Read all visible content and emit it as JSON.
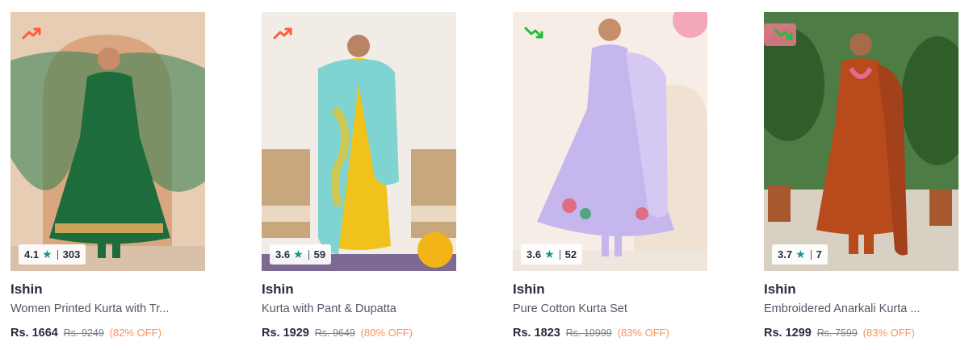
{
  "products": [
    {
      "brand": "Ishin",
      "title": "Women Printed Kurta with Tr...",
      "price": "Rs. 1664",
      "mrp": "Rs. 9249",
      "discount": "(82% OFF)",
      "rating": "4.1",
      "reviews": "303",
      "trend": "up",
      "trend_icon": "trending-up-icon",
      "trend_color": "#ff5a3c",
      "bg_color": "#e8d3bf",
      "garment_color": "#1e6b3c"
    },
    {
      "brand": "Ishin",
      "title": "Kurta with Pant & Dupatta",
      "price": "Rs. 1929",
      "mrp": "Rs. 9649",
      "discount": "(80% OFF)",
      "rating": "3.6",
      "reviews": "59",
      "trend": "up",
      "trend_icon": "trending-up-icon",
      "trend_color": "#ff5a3c",
      "bg_color": "#f2ede6",
      "garment_color": "#7fd3d1"
    },
    {
      "brand": "Ishin",
      "title": "Pure Cotton Kurta Set",
      "price": "Rs. 1823",
      "mrp": "Rs. 10999",
      "discount": "(83% OFF)",
      "rating": "3.6",
      "reviews": "52",
      "trend": "down",
      "trend_icon": "trending-down-icon",
      "trend_color": "#1fbf3a",
      "bg_color": "#f6efe8",
      "garment_color": "#c6b6ee"
    },
    {
      "brand": "Ishin",
      "title": "Embroidered Anarkali Kurta ...",
      "price": "Rs. 1299",
      "mrp": "Rs. 7599",
      "discount": "(83% OFF)",
      "rating": "3.7",
      "reviews": "7",
      "trend": "down",
      "trend_icon": "trending-down-icon",
      "trend_color": "#1fbf3a",
      "bg_color": "#4d7a45",
      "garment_color": "#b84a1c"
    }
  ],
  "colors": {
    "rating_star": "#14958f",
    "discount": "#ff905a",
    "mrp": "#7e818c",
    "brand_text": "#282c3f"
  }
}
